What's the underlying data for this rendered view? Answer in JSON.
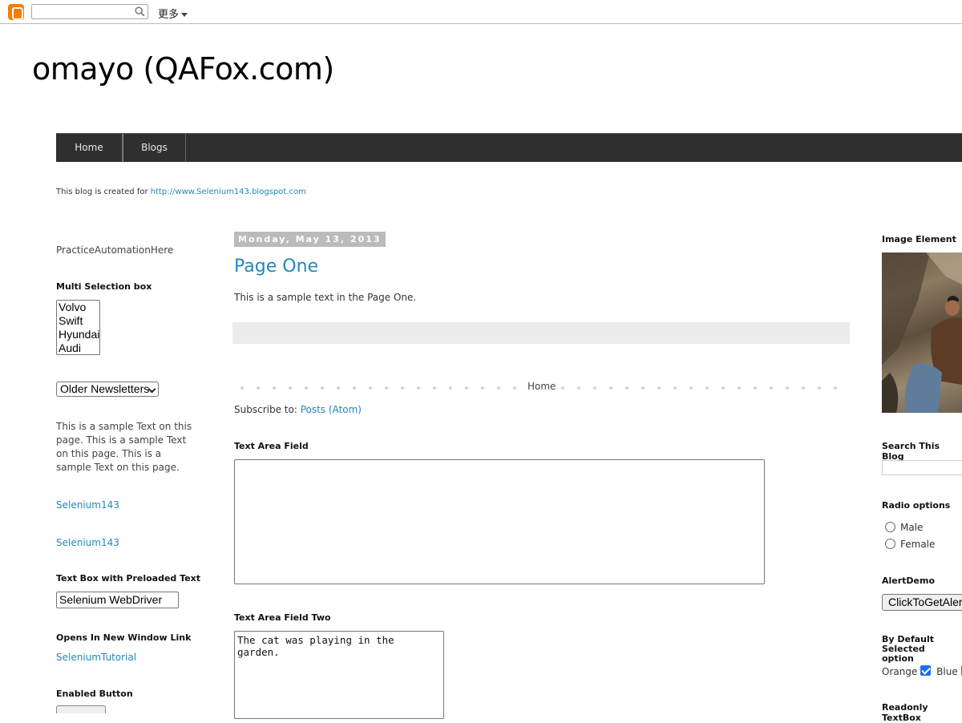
{
  "navbar": {
    "more_label": "更多",
    "search_placeholder": ""
  },
  "header": {
    "title": "omayo (QAFox.com)",
    "tabs": [
      {
        "label": "Home"
      },
      {
        "label": "Blogs"
      }
    ],
    "description_prefix": "This blog is created for ",
    "description_link": "http://www.Selenium143.blogspot.com"
  },
  "left": {
    "practice_text": "PracticeAutomationHere",
    "multi_select": {
      "title": "Multi Selection box",
      "options": [
        "Volvo",
        "Swift",
        "Hyundai",
        "Audi"
      ]
    },
    "dropdown_value": "Older Newsletters",
    "sample_text": "This is a sample Text on this page. This is a sample Text on this page. This is a sample Text on this page.",
    "links": [
      "Selenium143",
      "Selenium143"
    ],
    "preloaded": {
      "title": "Text Box with Preloaded Text",
      "value": "Selenium WebDriver"
    },
    "new_window": {
      "title": "Opens In New Window Link",
      "link": "SeleniumTutorial"
    },
    "enabled_button_title": "Enabled Button"
  },
  "main": {
    "date": "Monday, May 13, 2013",
    "post_title": "Page One",
    "post_body": "This is a sample text in the Page One.",
    "pager_home": "Home",
    "subscribe_prefix": "Subscribe to: ",
    "subscribe_link": "Posts (Atom)",
    "textarea1_title": "Text Area Field",
    "textarea1_value": "",
    "textarea2_title": "Text Area Field Two",
    "textarea2_value": "The cat was playing in the garden."
  },
  "right": {
    "image_title": "Image Element",
    "search_title": "Search This Blog",
    "radio_title": "Radio options",
    "radio_options": [
      "Male",
      "Female"
    ],
    "alert_title": "AlertDemo",
    "alert_button": "ClickToGetAlert",
    "default_selected_title_line1": "By Default Selected",
    "default_selected_title_line2": "option",
    "checkbox_orange": "Orange",
    "checkbox_blue": "Blue",
    "readonly_title": "Readonly TextBox"
  },
  "colors": {
    "link": "#2288bb",
    "tab_bar": "#2f2f2f",
    "date_bg": "#bbbbbb",
    "accent": "#f57d00"
  }
}
